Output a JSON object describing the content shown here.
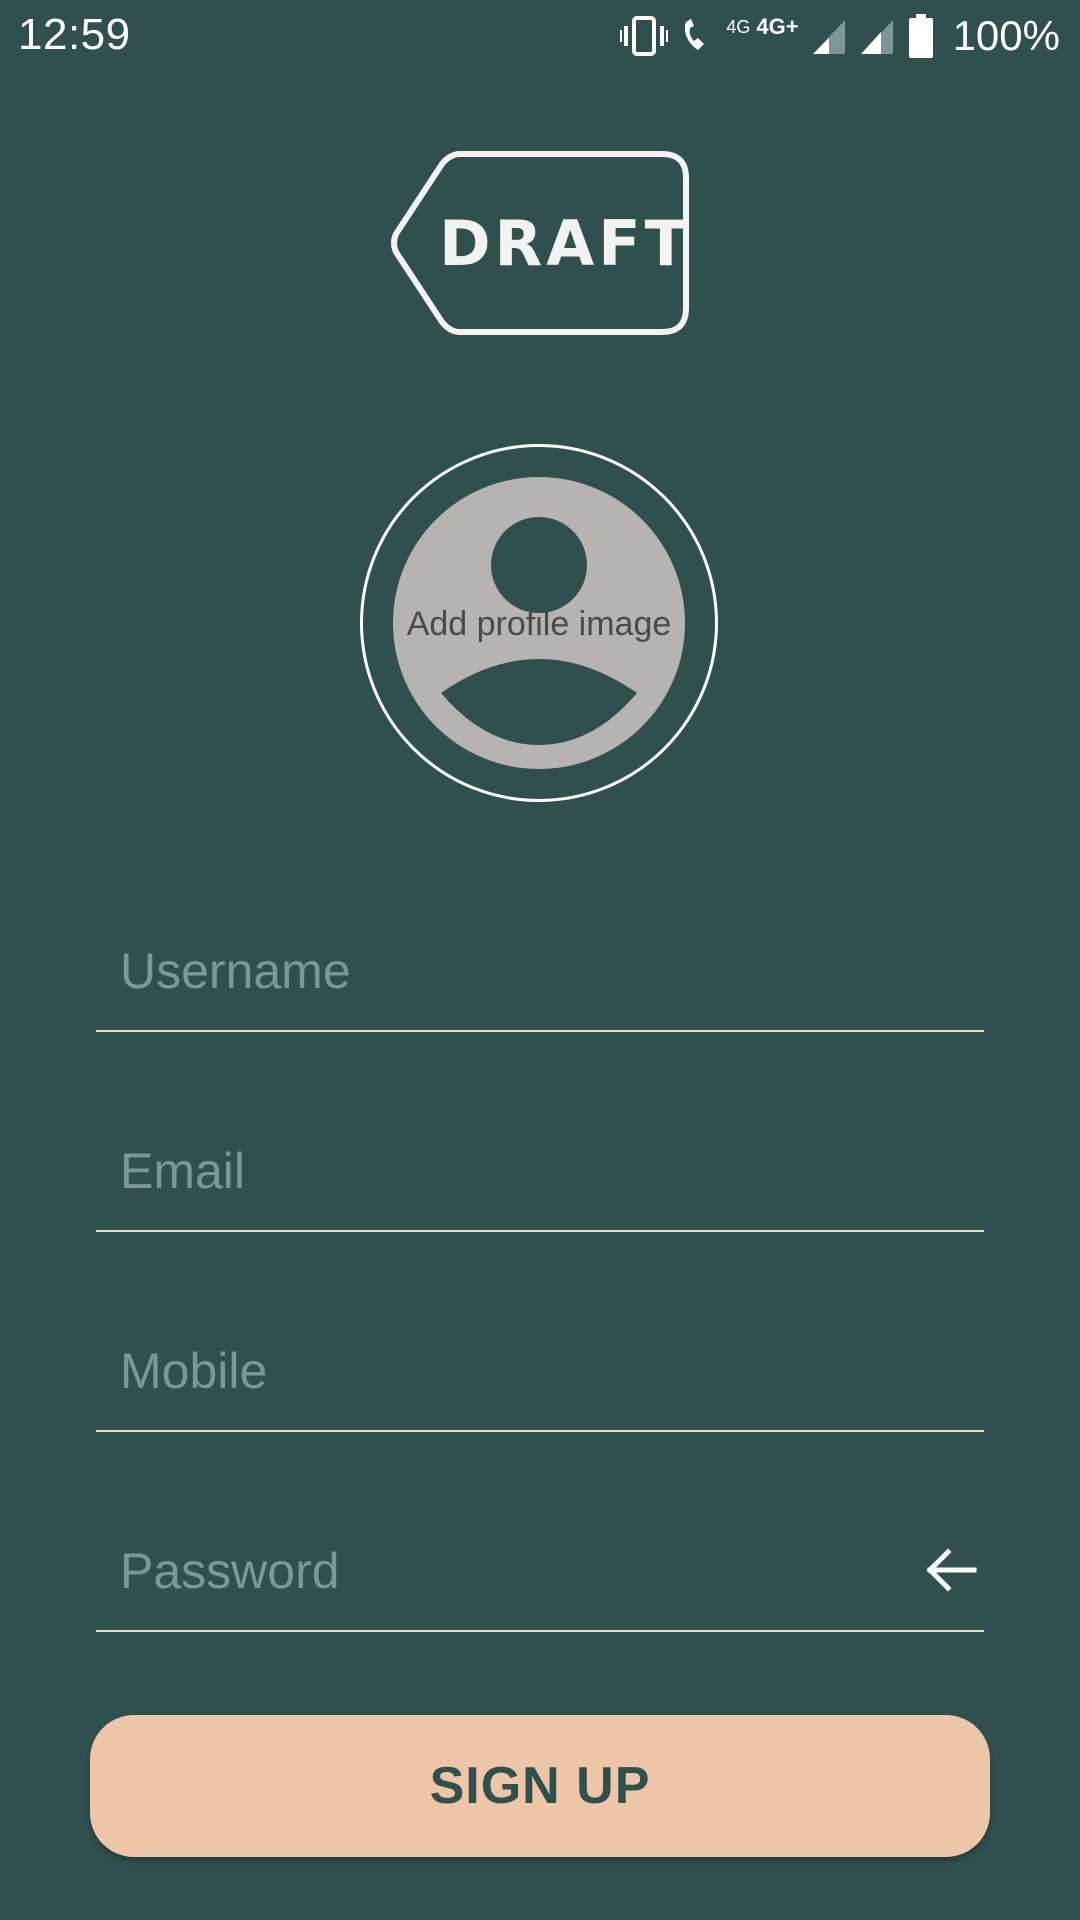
{
  "status_bar": {
    "time": "12:59",
    "network_small": "4G",
    "network_main": "4G+",
    "battery": "100%",
    "icons": [
      "vibrate-icon",
      "volte-call-icon",
      "signal-icon",
      "signal-icon",
      "battery-icon"
    ]
  },
  "logo": {
    "text": "DRAFT"
  },
  "avatar": {
    "label": "Add profile image"
  },
  "form": {
    "username_placeholder": "Username",
    "email_placeholder": "Email",
    "mobile_placeholder": "Mobile",
    "password_placeholder": "Password",
    "password_toggle_icon": "arrow-left-icon"
  },
  "signup": {
    "label": "SIGN UP"
  },
  "colors": {
    "background": "#30504f",
    "accent": "#ecc6a6",
    "field_line": "#efd9c1",
    "placeholder": "#7c9795",
    "avatar_fill": "#b7b3b3"
  }
}
